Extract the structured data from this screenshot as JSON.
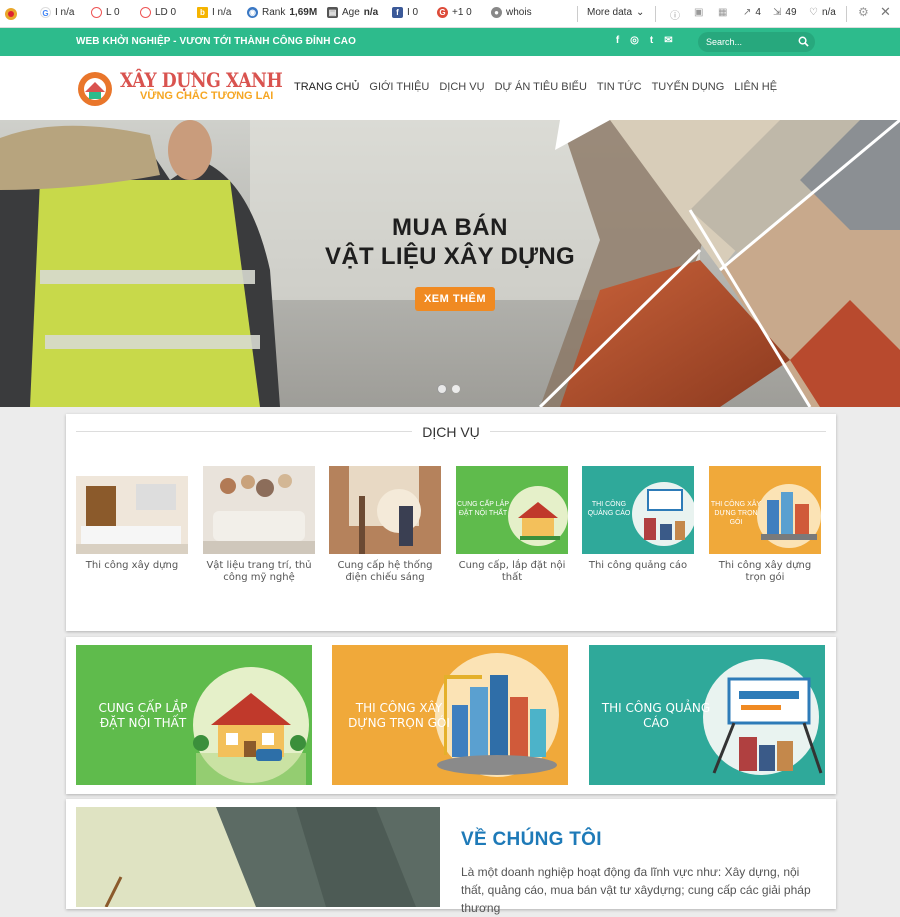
{
  "seobar": {
    "google_index": "I n/a",
    "links": "L 0",
    "linkdomains": "LD 0",
    "bing_index": "I n/a",
    "rank_label": "Rank",
    "rank_value": "1,69M",
    "age_label": "Age",
    "age_value": "n/a",
    "facebook": "I 0",
    "plusone": "+1 0",
    "whois": "whois",
    "more_data": "More data",
    "external_links": "4",
    "internal_links": "49",
    "nofollow": "n/a"
  },
  "topbar": {
    "tagline": "WEB KHỞI NGHIỆP - VƯƠN TỚI THÀNH CÔNG ĐỈNH CAO",
    "search_placeholder": "Search..."
  },
  "header": {
    "brand": "XÂY DỰNG XANH",
    "slogan": "VỮNG CHẮC TƯƠNG LAI",
    "nav": [
      "TRANG CHỦ",
      "GIỚI THIỆU",
      "DỊCH VỤ",
      "DỰ ÁN TIÊU BIỂU",
      "TIN TỨC",
      "TUYỂN DỤNG",
      "LIÊN HỆ"
    ]
  },
  "banner": {
    "line1": "MUA BÁN",
    "line2": "VẬT LIỆU XÂY DỰNG",
    "button": "XEM THÊM"
  },
  "services": {
    "title": "DỊCH VỤ",
    "items": [
      "Thi công xây dựng",
      "Vật liệu trang trí, thủ công mỹ nghệ",
      "Cung cấp hệ thống điện chiếu sáng",
      "Cung cấp, lắp đặt nội thất",
      "Thi công quảng cáo",
      "Thi công xây dựng trọn gói"
    ],
    "thumb_texts": [
      "CUNG CẤP LẮP ĐẶT NỘI THẤT",
      "THI CÔNG QUẢNG CÁO",
      "THI CÔNG XÂY DỰNG TRỌN GÓI"
    ]
  },
  "promos": [
    "CUNG CẤP LẮP ĐẶT NỘI THẤT",
    "THI CÔNG XÂY DỰNG TRỌN GÓI",
    "THI CÔNG QUẢNG CÁO"
  ],
  "about": {
    "title": "VỀ CHÚNG TÔI",
    "text": "Là một doanh nghiệp hoạt động đa lĩnh vực như: Xây dựng, nội thất, quảng cáo, mua bán vật tư xâydựng; cung cấp các giải pháp thương"
  },
  "colors": {
    "accent_green": "#2dbb8c",
    "orange": "#f08a22",
    "about_blue": "#1e7ab8"
  }
}
